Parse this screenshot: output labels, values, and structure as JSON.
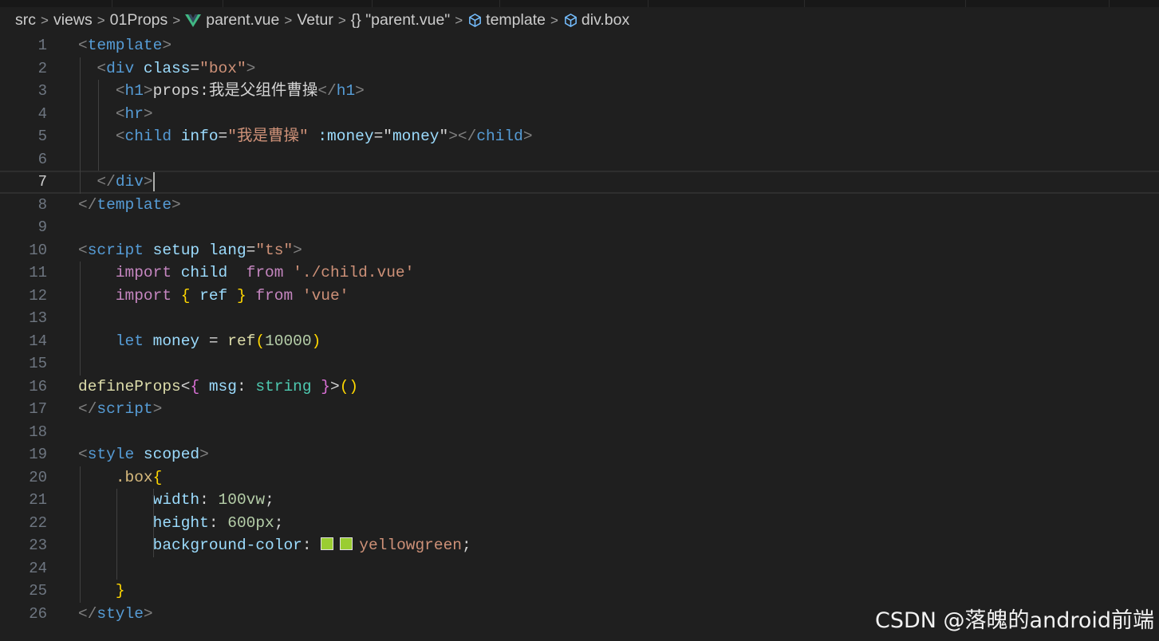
{
  "breadcrumb": {
    "items": [
      "src",
      "views",
      "01Props",
      "parent.vue",
      "Vetur",
      "{} \"parent.vue\"",
      "template",
      "div.box"
    ],
    "icons": {
      "vue": "vue-logo-icon",
      "braces": "braces-icon",
      "template": "cube-icon",
      "div_box": "cube-icon"
    },
    "separator": ">"
  },
  "editor": {
    "current_line": 7,
    "swatch_color": "#9acd32",
    "lines": [
      {
        "n": "1",
        "tokens": [
          {
            "c": "t-punc",
            "t": "<"
          },
          {
            "c": "t-tag",
            "t": "template"
          },
          {
            "c": "t-punc",
            "t": ">"
          }
        ]
      },
      {
        "n": "2",
        "tokens": [
          {
            "c": "t-text",
            "t": "  "
          },
          {
            "c": "t-punc",
            "t": "<"
          },
          {
            "c": "t-tag",
            "t": "div"
          },
          {
            "c": "t-text",
            "t": " "
          },
          {
            "c": "t-attr",
            "t": "class"
          },
          {
            "c": "t-text",
            "t": "="
          },
          {
            "c": "t-str",
            "t": "\"box\""
          },
          {
            "c": "t-punc",
            "t": ">"
          }
        ]
      },
      {
        "n": "3",
        "tokens": [
          {
            "c": "t-text",
            "t": "    "
          },
          {
            "c": "t-punc",
            "t": "<"
          },
          {
            "c": "t-tag",
            "t": "h1"
          },
          {
            "c": "t-punc",
            "t": ">"
          },
          {
            "c": "t-text",
            "t": "props:我是父组件曹操"
          },
          {
            "c": "t-punc",
            "t": "</"
          },
          {
            "c": "t-tag",
            "t": "h1"
          },
          {
            "c": "t-punc",
            "t": ">"
          }
        ]
      },
      {
        "n": "4",
        "tokens": [
          {
            "c": "t-text",
            "t": "    "
          },
          {
            "c": "t-punc",
            "t": "<"
          },
          {
            "c": "t-tag",
            "t": "hr"
          },
          {
            "c": "t-punc",
            "t": ">"
          }
        ]
      },
      {
        "n": "5",
        "tokens": [
          {
            "c": "t-text",
            "t": "    "
          },
          {
            "c": "t-punc",
            "t": "<"
          },
          {
            "c": "t-tag",
            "t": "child"
          },
          {
            "c": "t-text",
            "t": " "
          },
          {
            "c": "t-attr",
            "t": "info"
          },
          {
            "c": "t-text",
            "t": "="
          },
          {
            "c": "t-str",
            "t": "\"我是曹操\""
          },
          {
            "c": "t-text",
            "t": " "
          },
          {
            "c": "t-attr",
            "t": ":money"
          },
          {
            "c": "t-text",
            "t": "="
          },
          {
            "c": "t-text",
            "t": "\""
          },
          {
            "c": "t-var",
            "t": "money"
          },
          {
            "c": "t-text",
            "t": "\""
          },
          {
            "c": "t-punc",
            "t": "></"
          },
          {
            "c": "t-tag",
            "t": "child"
          },
          {
            "c": "t-punc",
            "t": ">"
          }
        ]
      },
      {
        "n": "6",
        "tokens": []
      },
      {
        "n": "7",
        "tokens": [
          {
            "c": "t-text",
            "t": "  "
          },
          {
            "c": "t-punc",
            "t": "</"
          },
          {
            "c": "t-tag",
            "t": "div"
          },
          {
            "c": "t-punc",
            "t": ">"
          }
        ]
      },
      {
        "n": "8",
        "tokens": [
          {
            "c": "t-punc",
            "t": "</"
          },
          {
            "c": "t-tag",
            "t": "template"
          },
          {
            "c": "t-punc",
            "t": ">"
          }
        ]
      },
      {
        "n": "9",
        "tokens": []
      },
      {
        "n": "10",
        "tokens": [
          {
            "c": "t-punc",
            "t": "<"
          },
          {
            "c": "t-tag",
            "t": "script"
          },
          {
            "c": "t-text",
            "t": " "
          },
          {
            "c": "t-attr",
            "t": "setup"
          },
          {
            "c": "t-text",
            "t": " "
          },
          {
            "c": "t-attr",
            "t": "lang"
          },
          {
            "c": "t-text",
            "t": "="
          },
          {
            "c": "t-str",
            "t": "\"ts\""
          },
          {
            "c": "t-punc",
            "t": ">"
          }
        ]
      },
      {
        "n": "11",
        "tokens": [
          {
            "c": "t-text",
            "t": "    "
          },
          {
            "c": "t-kw",
            "t": "import"
          },
          {
            "c": "t-text",
            "t": " "
          },
          {
            "c": "t-var",
            "t": "child"
          },
          {
            "c": "t-text",
            "t": "  "
          },
          {
            "c": "t-kw",
            "t": "from"
          },
          {
            "c": "t-text",
            "t": " "
          },
          {
            "c": "t-str",
            "t": "'./child.vue'"
          }
        ]
      },
      {
        "n": "12",
        "tokens": [
          {
            "c": "t-text",
            "t": "    "
          },
          {
            "c": "t-kw",
            "t": "import"
          },
          {
            "c": "t-text",
            "t": " "
          },
          {
            "c": "t-br1",
            "t": "{"
          },
          {
            "c": "t-text",
            "t": " "
          },
          {
            "c": "t-var",
            "t": "ref"
          },
          {
            "c": "t-text",
            "t": " "
          },
          {
            "c": "t-br1",
            "t": "}"
          },
          {
            "c": "t-text",
            "t": " "
          },
          {
            "c": "t-kw",
            "t": "from"
          },
          {
            "c": "t-text",
            "t": " "
          },
          {
            "c": "t-str",
            "t": "'vue'"
          }
        ]
      },
      {
        "n": "13",
        "tokens": []
      },
      {
        "n": "14",
        "tokens": [
          {
            "c": "t-text",
            "t": "    "
          },
          {
            "c": "t-let",
            "t": "let"
          },
          {
            "c": "t-text",
            "t": " "
          },
          {
            "c": "t-var",
            "t": "money"
          },
          {
            "c": "t-text",
            "t": " = "
          },
          {
            "c": "t-fn",
            "t": "ref"
          },
          {
            "c": "t-br1",
            "t": "("
          },
          {
            "c": "t-num",
            "t": "10000"
          },
          {
            "c": "t-br1",
            "t": ")"
          }
        ]
      },
      {
        "n": "15",
        "tokens": []
      },
      {
        "n": "16",
        "tokens": [
          {
            "c": "t-fn",
            "t": "defineProps"
          },
          {
            "c": "t-text",
            "t": "<"
          },
          {
            "c": "t-br2",
            "t": "{"
          },
          {
            "c": "t-text",
            "t": " "
          },
          {
            "c": "t-var",
            "t": "msg"
          },
          {
            "c": "t-text",
            "t": ": "
          },
          {
            "c": "t-type",
            "t": "string"
          },
          {
            "c": "t-text",
            "t": " "
          },
          {
            "c": "t-br2",
            "t": "}"
          },
          {
            "c": "t-text",
            "t": ">"
          },
          {
            "c": "t-br1",
            "t": "()"
          }
        ]
      },
      {
        "n": "17",
        "tokens": [
          {
            "c": "t-punc",
            "t": "</"
          },
          {
            "c": "t-tag",
            "t": "script"
          },
          {
            "c": "t-punc",
            "t": ">"
          }
        ]
      },
      {
        "n": "18",
        "tokens": []
      },
      {
        "n": "19",
        "tokens": [
          {
            "c": "t-punc",
            "t": "<"
          },
          {
            "c": "t-tag",
            "t": "style"
          },
          {
            "c": "t-text",
            "t": " "
          },
          {
            "c": "t-attr",
            "t": "scoped"
          },
          {
            "c": "t-punc",
            "t": ">"
          }
        ]
      },
      {
        "n": "20",
        "tokens": [
          {
            "c": "t-text",
            "t": "    "
          },
          {
            "c": "t-sel",
            "t": ".box"
          },
          {
            "c": "t-br1",
            "t": "{"
          }
        ]
      },
      {
        "n": "21",
        "tokens": [
          {
            "c": "t-text",
            "t": "        "
          },
          {
            "c": "t-prop",
            "t": "width"
          },
          {
            "c": "t-text",
            "t": ": "
          },
          {
            "c": "t-num",
            "t": "100vw"
          },
          {
            "c": "t-text",
            "t": ";"
          }
        ]
      },
      {
        "n": "22",
        "tokens": [
          {
            "c": "t-text",
            "t": "        "
          },
          {
            "c": "t-prop",
            "t": "height"
          },
          {
            "c": "t-text",
            "t": ": "
          },
          {
            "c": "t-num",
            "t": "600px"
          },
          {
            "c": "t-text",
            "t": ";"
          }
        ]
      },
      {
        "n": "23",
        "tokens": [
          {
            "c": "t-text",
            "t": "        "
          },
          {
            "c": "t-prop",
            "t": "background-color"
          },
          {
            "c": "t-text",
            "t": ": "
          },
          {
            "c": "swatch",
            "t": ""
          },
          {
            "c": "swatch",
            "t": ""
          },
          {
            "c": "t-str",
            "t": "yellowgreen"
          },
          {
            "c": "t-text",
            "t": ";"
          }
        ]
      },
      {
        "n": "24",
        "tokens": []
      },
      {
        "n": "25",
        "tokens": [
          {
            "c": "t-text",
            "t": "    "
          },
          {
            "c": "t-br1",
            "t": "}"
          }
        ]
      },
      {
        "n": "26",
        "tokens": [
          {
            "c": "t-punc",
            "t": "</"
          },
          {
            "c": "t-tag",
            "t": "style"
          },
          {
            "c": "t-punc",
            "t": ">"
          }
        ]
      }
    ]
  },
  "watermark": "CSDN @落魄的android前端"
}
